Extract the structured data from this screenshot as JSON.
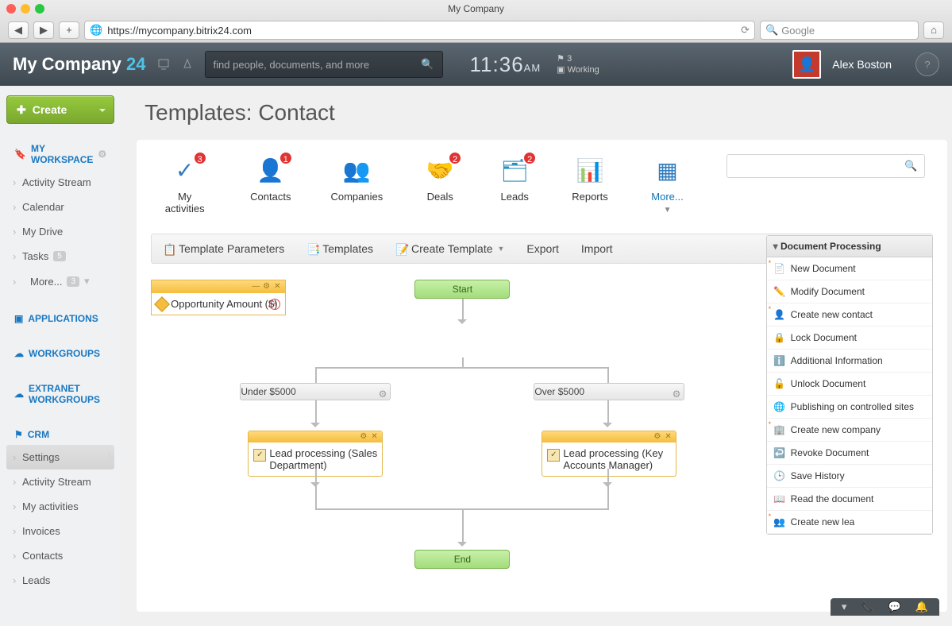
{
  "browser": {
    "title": "My Company",
    "url": "https://mycompany.bitrix24.com",
    "search_placeholder": "Google"
  },
  "header": {
    "brand": "My Company",
    "brand_suffix": "24",
    "search_placeholder": "find people, documents, and more",
    "time": "11:36",
    "ampm": "AM",
    "flag_count": "3",
    "status": "Working",
    "user": "Alex Boston"
  },
  "sidebar": {
    "create_label": "Create",
    "sections": [
      {
        "heading": "MY WORKSPACE",
        "icon": "bookmark",
        "gear": true,
        "items": [
          {
            "label": "Activity Stream"
          },
          {
            "label": "Calendar"
          },
          {
            "label": "My Drive"
          },
          {
            "label": "Tasks",
            "badge": "5"
          },
          {
            "label": "More...",
            "badge": "3",
            "sub": true
          }
        ]
      },
      {
        "heading": "APPLICATIONS",
        "icon": "cube"
      },
      {
        "heading": "WORKGROUPS",
        "icon": "cloud"
      },
      {
        "heading": "EXTRANET WORKGROUPS",
        "icon": "cloud"
      },
      {
        "heading": "CRM",
        "icon": "flag",
        "items": [
          {
            "label": "Settings",
            "active": true
          },
          {
            "label": "Activity Stream"
          },
          {
            "label": "My activities"
          },
          {
            "label": "Invoices"
          },
          {
            "label": "Contacts"
          },
          {
            "label": "Leads"
          }
        ]
      }
    ]
  },
  "page": {
    "title": "Templates: Contact"
  },
  "tabs": [
    {
      "label": "My activities",
      "badge": "3",
      "icon": "✓",
      "color": "#2e7bbd"
    },
    {
      "label": "Contacts",
      "badge": "1",
      "icon": "👤",
      "color": "#c48030"
    },
    {
      "label": "Companies",
      "icon": "👥",
      "color": "#6aa83c"
    },
    {
      "label": "Deals",
      "badge": "2",
      "icon": "🤝",
      "color": "#c47a30"
    },
    {
      "label": "Leads",
      "badge": "2",
      "icon": "🗂",
      "color": "#2e90bd"
    },
    {
      "label": "Reports",
      "icon": "📊",
      "color": "#2e7bbd"
    },
    {
      "label": "More...",
      "icon": "▦",
      "color": "#2e7bbd",
      "more": true
    }
  ],
  "actionbar": [
    {
      "label": "Template Parameters"
    },
    {
      "label": "Templates"
    },
    {
      "label": "Create Template",
      "dropdown": true
    },
    {
      "label": "Export"
    },
    {
      "label": "Import"
    }
  ],
  "workflow": {
    "start": "Start",
    "end": "End",
    "decision": "Opportunity Amount ($)",
    "branch_left": "Under $5000",
    "branch_right": "Over $5000",
    "proc_left": "Lead processing (Sales Department)",
    "proc_right": "Lead processing (Key Accounts Manager)"
  },
  "right_panel": {
    "heading": "Document Processing",
    "items": [
      {
        "label": "New Document",
        "star": true,
        "icon": "📄"
      },
      {
        "label": "Modify Document",
        "icon": "✏️"
      },
      {
        "label": "Create new contact",
        "star": true,
        "icon": "👤"
      },
      {
        "label": "Lock Document",
        "icon": "🔒"
      },
      {
        "label": "Additional Information",
        "icon": "ℹ️"
      },
      {
        "label": "Unlock Document",
        "icon": "🔓"
      },
      {
        "label": "Publishing on controlled sites",
        "icon": "🌐"
      },
      {
        "label": "Create new company",
        "star": true,
        "icon": "🏢"
      },
      {
        "label": "Revoke Document",
        "icon": "↩️"
      },
      {
        "label": "Save History",
        "icon": "🕒"
      },
      {
        "label": "Read the document",
        "icon": "📖"
      },
      {
        "label": "Create new lea",
        "star": true,
        "icon": "👥"
      }
    ]
  }
}
